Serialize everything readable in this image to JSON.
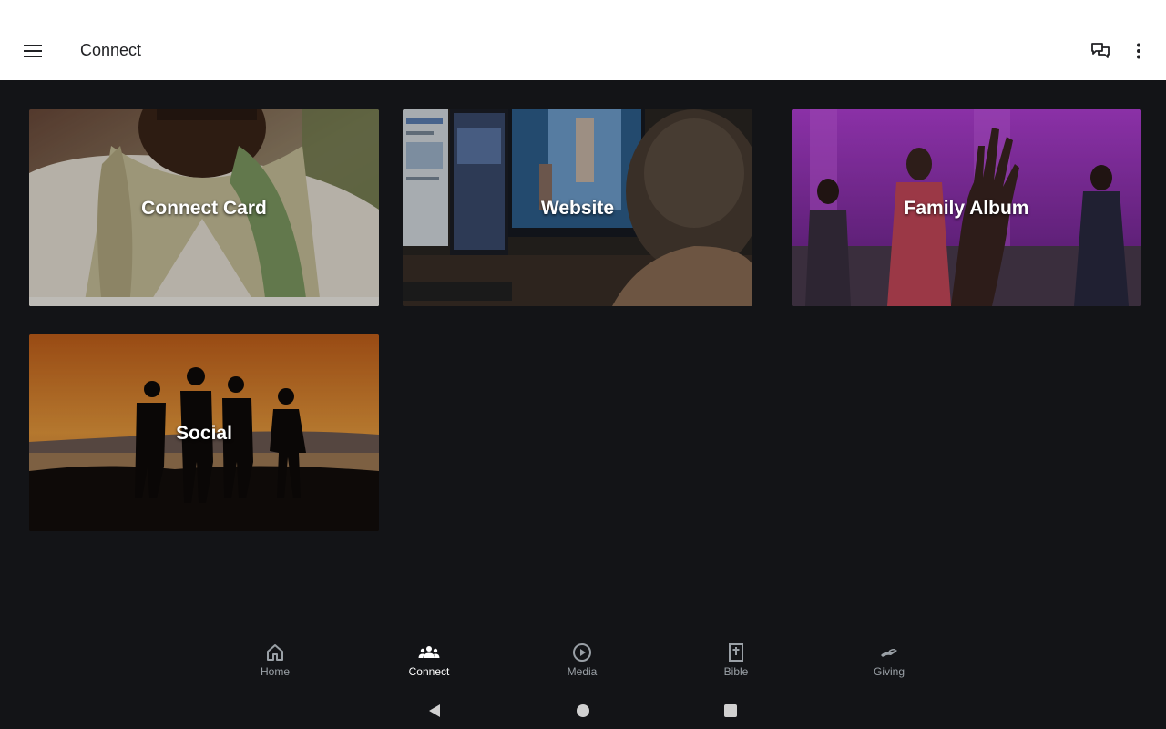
{
  "app_bar": {
    "title": "Connect",
    "menu_icon": "hamburger-menu-icon",
    "chat_icon": "chat-bubbles-icon",
    "more_icon": "more-vertical-icon",
    "background": "#ffffff"
  },
  "cards": [
    {
      "label": "Connect Card"
    },
    {
      "label": "Website"
    },
    {
      "label": "Family Album"
    },
    {
      "label": "Social"
    }
  ],
  "bottom_nav": {
    "items": [
      {
        "label": "Home",
        "icon": "home-icon",
        "active": false
      },
      {
        "label": "Connect",
        "icon": "people-group-icon",
        "active": true
      },
      {
        "label": "Media",
        "icon": "play-circle-icon",
        "active": false
      },
      {
        "label": "Bible",
        "icon": "bible-cross-icon",
        "active": false
      },
      {
        "label": "Giving",
        "icon": "giving-hand-icon",
        "active": false
      }
    ],
    "active_color": "#ffffff",
    "inactive_color": "#9aa0a6"
  },
  "system_nav": {
    "back_icon": "back-triangle-icon",
    "home_icon": "home-circle-icon",
    "recents_icon": "recents-square-icon"
  },
  "colors": {
    "background": "#131417"
  }
}
